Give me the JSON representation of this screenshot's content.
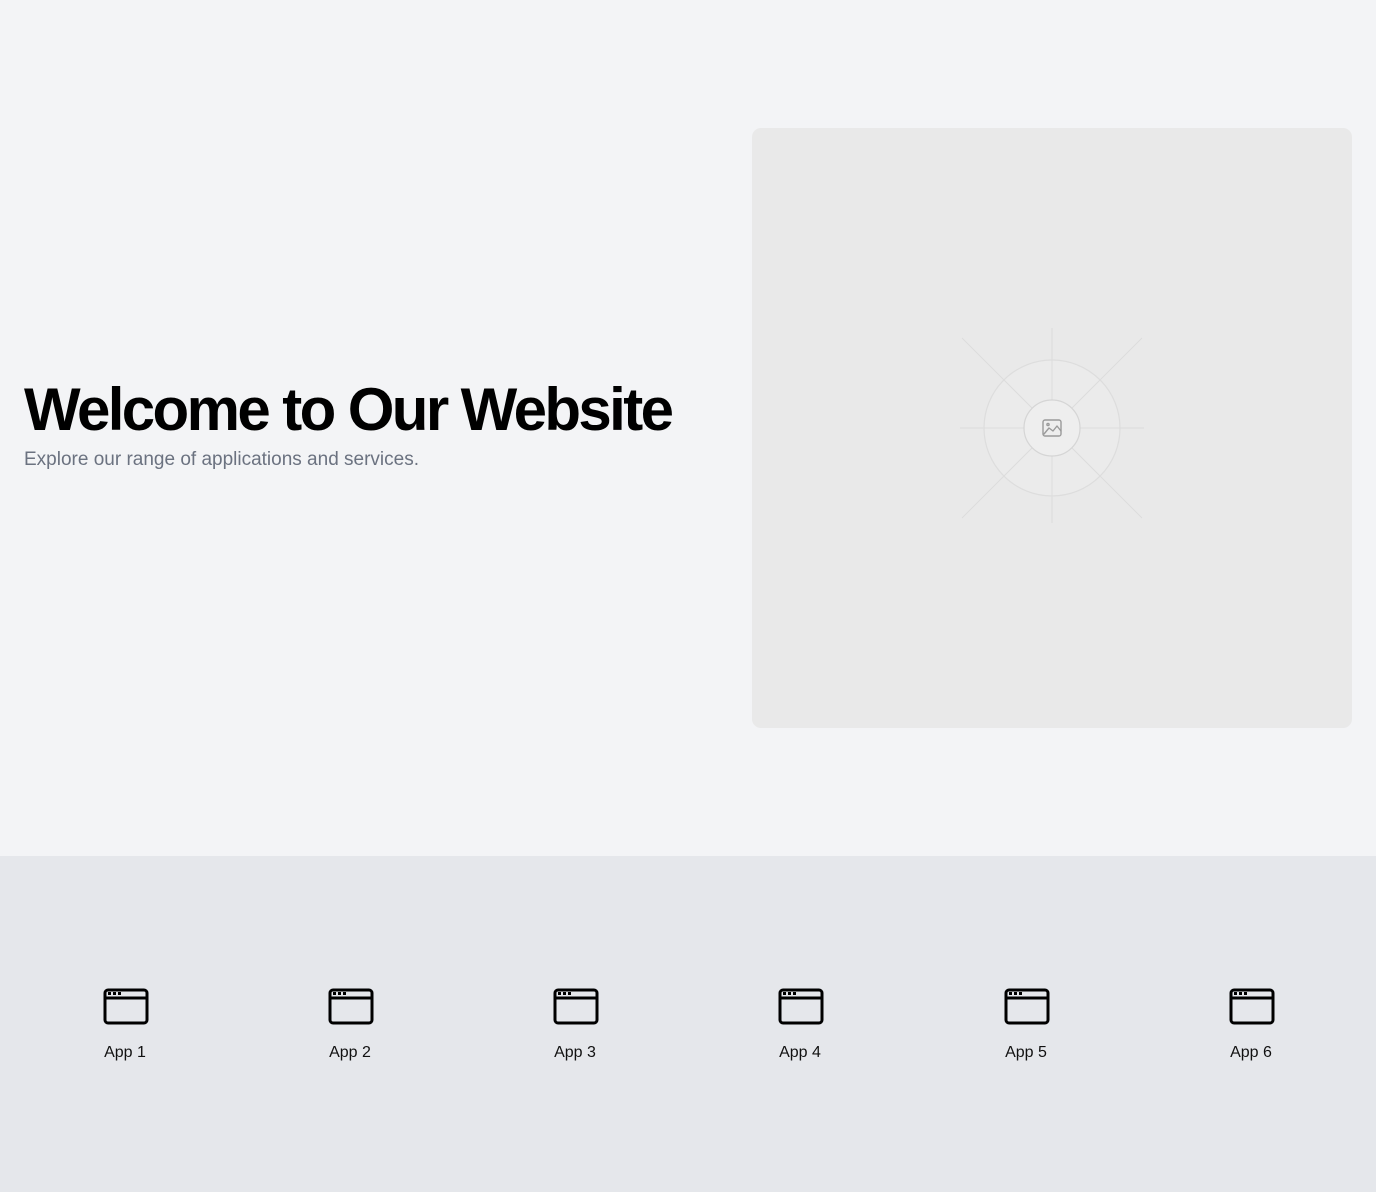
{
  "hero": {
    "title": "Welcome to Our Website",
    "subtitle": "Explore our range of applications and services.",
    "image_icon": "image-icon"
  },
  "apps": {
    "icon": "browser-window-icon",
    "items": [
      {
        "label": "App 1"
      },
      {
        "label": "App 2"
      },
      {
        "label": "App 3"
      },
      {
        "label": "App 4"
      },
      {
        "label": "App 5"
      },
      {
        "label": "App 6"
      }
    ]
  },
  "colors": {
    "page_background": "#f3f4f6",
    "apps_background": "#e5e7eb",
    "placeholder_background": "#e9e9e9",
    "title": "#000000",
    "subtitle": "#6b7280"
  }
}
